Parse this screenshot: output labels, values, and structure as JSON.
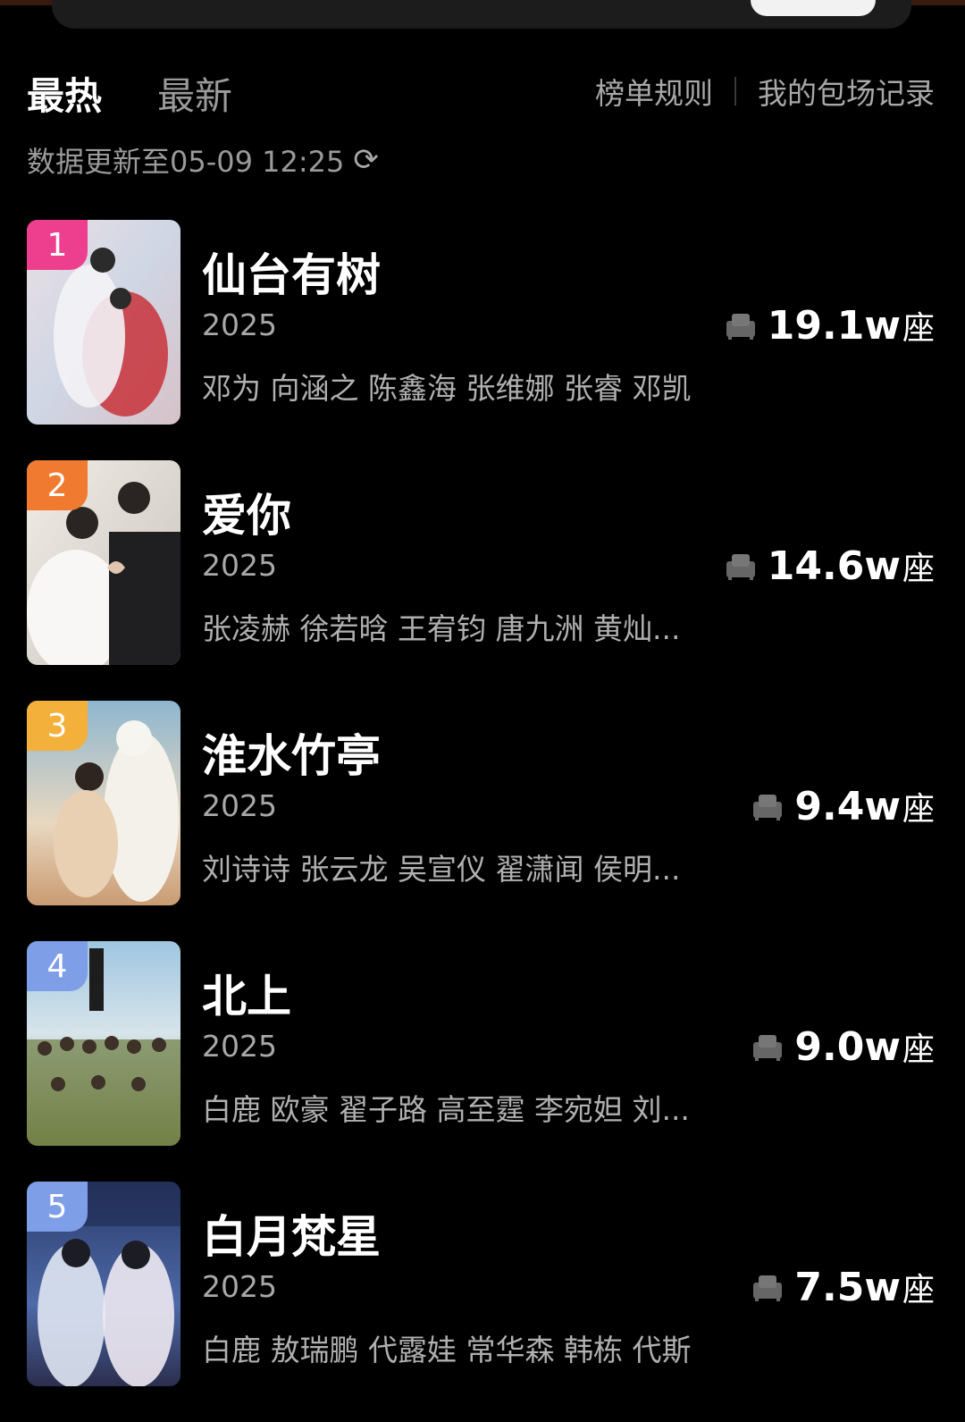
{
  "header": {
    "tabs": [
      {
        "label": "最热",
        "active": true
      },
      {
        "label": "最新",
        "active": false
      }
    ],
    "links": {
      "rules": "榜单规则",
      "history": "我的包场记录"
    },
    "updated_text": "数据更新至05-09 12:25",
    "refresh_icon": "refresh-icon"
  },
  "colors": {
    "rank_1": "#ee3f8f",
    "rank_2": "#f07a2f",
    "rank_3": "#f3b03b",
    "rank_4": "#7f9ee8",
    "rank_5": "#7f9ee8"
  },
  "items": [
    {
      "rank": "1",
      "title": "仙台有树",
      "year": "2025",
      "seats": "19.1w",
      "unit": "座",
      "cast": "邓为 向涵之 陈鑫海 张维娜 张睿 邓凯"
    },
    {
      "rank": "2",
      "title": "爱你",
      "year": "2025",
      "seats": "14.6w",
      "unit": "座",
      "cast": "张凌赫 徐若晗 王宥钧 唐九洲 黄灿..."
    },
    {
      "rank": "3",
      "title": "淮水竹亭",
      "year": "2025",
      "seats": "9.4w",
      "unit": "座",
      "cast": "刘诗诗 张云龙 吴宣仪 翟潇闻 侯明..."
    },
    {
      "rank": "4",
      "title": "北上",
      "year": "2025",
      "seats": "9.0w",
      "unit": "座",
      "cast": "白鹿 欧豪 翟子路 高至霆 李宛妲 刘..."
    },
    {
      "rank": "5",
      "title": "白月梵星",
      "year": "2025",
      "seats": "7.5w",
      "unit": "座",
      "cast": "白鹿 敖瑞鹏 代露娃 常华森 韩栋 代斯"
    }
  ]
}
